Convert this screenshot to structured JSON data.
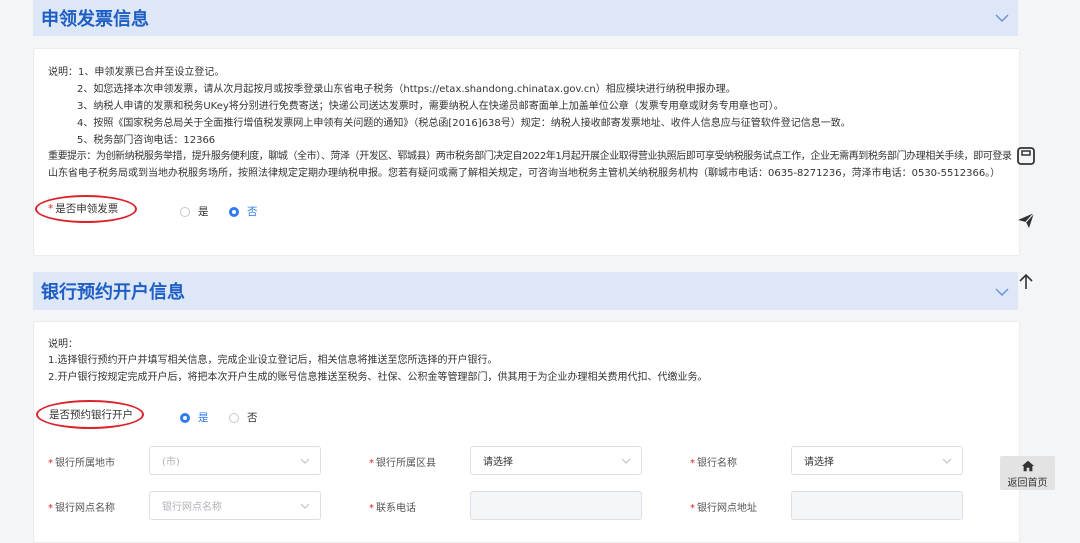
{
  "invoice_section": {
    "title": "申领发票信息",
    "notes": [
      "说明：1、申领发票已合并至设立登记。",
      "2、如您选择本次申领发票，请从次月起按月或按季登录山东省电子税务（https://etax.shandong.chinatax.gov.cn）相应模块进行纳税申报办理。",
      "3、纳税人申请的发票和税务UKey将分别进行免费寄送；快递公司送达发票时，需要纳税人在快递员邮寄面单上加盖单位公章（发票专用章或财务专用章也可）。",
      "4、按照《国家税务总局关于全面推行增值税发票网上申领有关问题的通知》（税总函[2016]638号）规定：纳税人接收邮寄发票地址、收件人信息应与征管软件登记信息一致。",
      "5、税务部门咨询电话：12366"
    ],
    "tip_line1": "重要提示：为创新纳税服务举措，提升服务便利度，聊城（全市）、菏泽（开发区、郓城县）两市税务部门决定自2022年1月起开展企业取得营业执照后即可享受纳税服务试点工作，企业无需再到税务部门办理相关手续，即可登录",
    "tip_line2": "山东省电子税务局或到当地办税服务场所，按照法律规定定期办理纳税申报。您若有疑问或需了解相关规定，可咨询当地税务主管机关纳税服务机构（聊城市电话：0635-8271236，菏泽市电话：0530-5512366。）",
    "question_required": "*",
    "question": "是否申领发票",
    "option_yes": "是",
    "option_no": "否",
    "selected": "否"
  },
  "bank_section": {
    "title": "银行预约开户信息",
    "notes": [
      "说明：",
      "1.选择银行预约开户并填写相关信息，完成企业设立登记后，相关信息将推送至您所选择的开户银行。",
      "2.开户银行按规定完成开户后，将把本次开户生成的账号信息推送至税务、社保、公积金等管理部门，供其用于为企业办理相关费用代扣、代缴业务。"
    ],
    "question": "是否预约银行开户",
    "option_yes": "是",
    "option_no": "否",
    "selected": "是",
    "fields": {
      "city_label": "银行所属地市",
      "city_placeholder": "(市)",
      "district_label": "银行所属区县",
      "district_value": "请选择",
      "bank_name_label": "银行名称",
      "bank_name_value": "请选择",
      "branch_label": "银行网点名称",
      "branch_placeholder": "银行网点名称",
      "phone_label": "联系电话",
      "address_label": "银行网点地址"
    }
  },
  "side": {
    "home_label": "返回首页",
    "icons": [
      "save-icon",
      "send-icon",
      "arrow-up-icon",
      "home-icon"
    ]
  },
  "colors": {
    "primary": "#2f7bf2",
    "title": "#1f5fc4",
    "header_bg": "#dde7f8",
    "annotation_red": "#d9242b"
  }
}
